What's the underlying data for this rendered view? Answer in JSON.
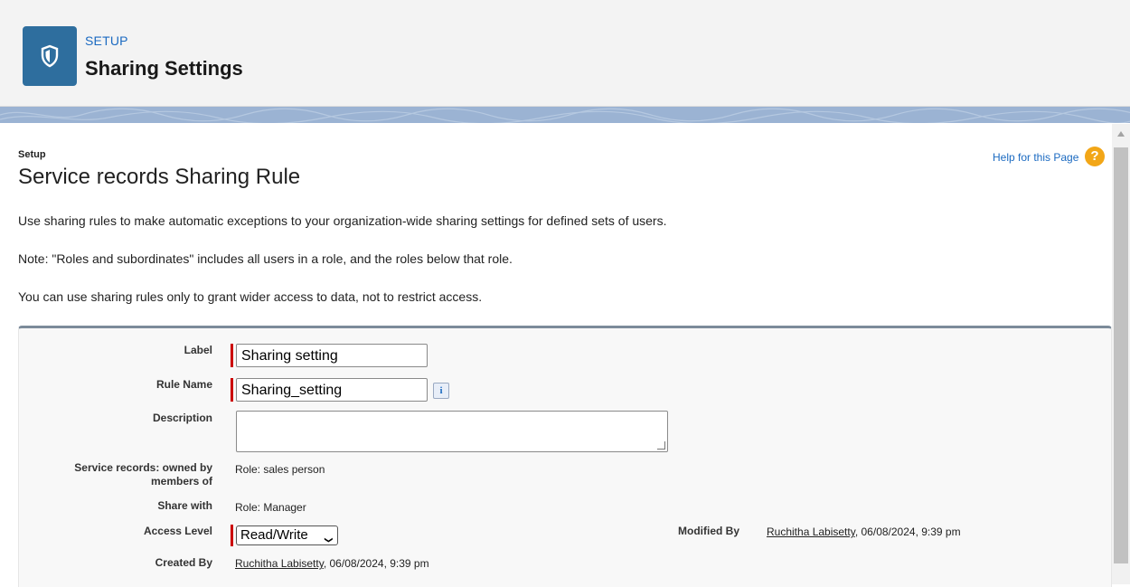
{
  "header": {
    "setup_label": "SETUP",
    "title": "Sharing Settings",
    "icon": "shield-icon"
  },
  "page": {
    "breadcrumb": "Setup",
    "title": "Service records Sharing Rule",
    "help_link": "Help for this Page",
    "help_icon": "?",
    "intro": "Use sharing rules to make automatic exceptions to your organization-wide sharing settings for defined sets of users.",
    "note": "Note: \"Roles and subordinates\" includes all users in a role, and the roles below that role.",
    "restriction": "You can use sharing rules only to grant wider access to data, not to restrict access."
  },
  "form": {
    "label_label": "Label",
    "label_value": "Sharing setting",
    "rule_name_label": "Rule Name",
    "rule_name_value": "Sharing_setting",
    "info_icon": "i",
    "description_label": "Description",
    "description_value": "",
    "owned_by_label": "Service records: owned by members of",
    "owned_by_value": "Role: sales person",
    "share_with_label": "Share with",
    "share_with_value": "Role: Manager",
    "access_level_label": "Access Level",
    "access_level_value": "Read/Write",
    "created_by_label": "Created By",
    "created_by_user": "Ruchitha Labisetty",
    "created_by_date": ", 06/08/2024, 9:39 pm",
    "modified_by_label": "Modified By",
    "modified_by_user": "Ruchitha Labisetty",
    "modified_by_date": ", 06/08/2024, 9:39 pm"
  },
  "colors": {
    "accent": "#1b6ac1",
    "brand_icon": "#2e6e9e",
    "required": "#cc0000"
  }
}
